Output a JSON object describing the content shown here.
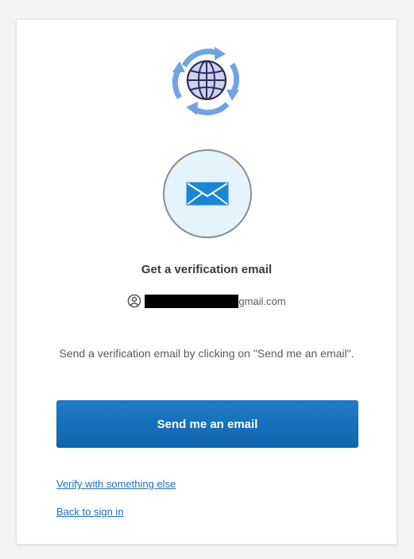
{
  "verification": {
    "title": "Get a verification email",
    "email_visible_suffix": "gmail.com",
    "instructions": "Send a verification email by clicking on \"Send me an email\".",
    "send_button_label": "Send me an email"
  },
  "links": {
    "verify_other": "Verify with something else",
    "back_to_sign_in": "Back to sign in"
  },
  "icons": {
    "logo": "globe-arrows-icon",
    "factor": "envelope-icon",
    "identifier": "user-circle-icon"
  },
  "colors": {
    "primary_button": "#1a72bb",
    "link": "#1d6fb8",
    "logo_blue": "#5b8fd6",
    "logo_purple": "#7f86c8",
    "mail_circle_bg": "#e5f3fc"
  }
}
